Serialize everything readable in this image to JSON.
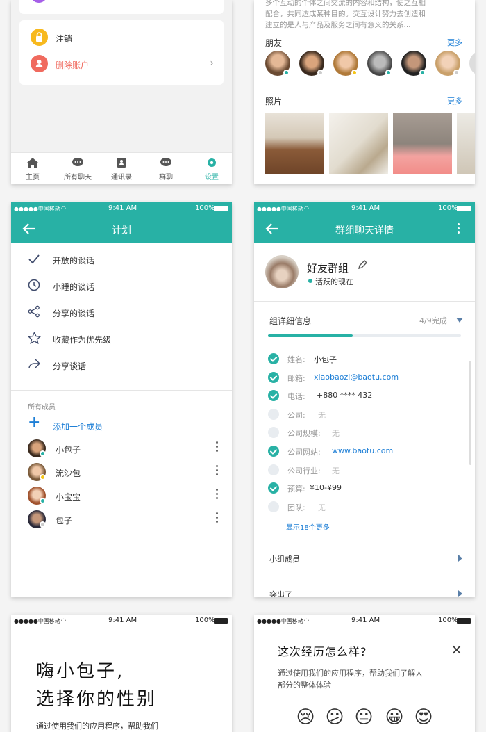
{
  "settings_tail": {
    "logout": "注销",
    "delete_account": "删除账户",
    "tabs": [
      {
        "label": "主页",
        "icon": "home-icon"
      },
      {
        "label": "所有聊天",
        "icon": "chat-icon"
      },
      {
        "label": "通讯录",
        "icon": "contacts-icon"
      },
      {
        "label": "群聊",
        "icon": "group-chat-icon"
      },
      {
        "label": "设置",
        "icon": "gear-icon"
      }
    ]
  },
  "profile_tail": {
    "desc_line1": "多个互动的个体之间交流的内容和结构，使之互相",
    "desc_line2": "配合，共同达成某种目的。交互设计努力去创造和",
    "desc_line3": "建立的是人与产品及服务之间有意义的关系...",
    "friends_title": "朋友",
    "friends_more": "更多",
    "photos_title": "照片",
    "photos_more": "更多"
  },
  "status": {
    "carrier": "●●●●●中国移动",
    "time": "9:41 AM",
    "battery": "100%"
  },
  "plan": {
    "title": "计划",
    "actions": [
      {
        "icon": "check-icon",
        "label": "开放的谈话"
      },
      {
        "icon": "clock-icon",
        "label": "小睡的谈话"
      },
      {
        "icon": "share-icon",
        "label": "分享的谈话"
      },
      {
        "icon": "star-icon",
        "label": "收藏作为优先级"
      },
      {
        "icon": "forward-icon",
        "label": "分享谈话"
      }
    ],
    "members_title": "所有成员",
    "add_member": "添加一个成员",
    "members": [
      {
        "name": "小包子",
        "status_color": "#28b1a5"
      },
      {
        "name": "流沙包",
        "status_color": "#f5c518"
      },
      {
        "name": "小宝宝",
        "status_color": "#28b1a5"
      },
      {
        "name": "包子",
        "status_color": "#cccccc"
      }
    ]
  },
  "group": {
    "title": "群组聊天详情",
    "name": "好友群组",
    "status": "活跃的现在",
    "section": "组详细信息",
    "progress_text": "4/9完成",
    "progress": 0.44,
    "fields": [
      {
        "k": "姓名:",
        "v": "小包子",
        "done": true,
        "style": ""
      },
      {
        "k": "邮箱:",
        "v": "xiaobaozi@baotu.com",
        "done": true,
        "style": "link"
      },
      {
        "k": "电话:",
        "v": "+880 **** 432",
        "done": true,
        "style": ""
      },
      {
        "k": "公司:",
        "v": "无",
        "done": false,
        "style": "none"
      },
      {
        "k": "公司规模:",
        "v": "无",
        "done": false,
        "style": "none"
      },
      {
        "k": "公司网站:",
        "v": "www.baotu.com",
        "done": true,
        "style": "link"
      },
      {
        "k": "公司行业:",
        "v": "无",
        "done": false,
        "style": "none"
      },
      {
        "k": "预算:",
        "v": "¥10-¥99",
        "done": true,
        "style": ""
      },
      {
        "k": "团队:",
        "v": "无",
        "done": false,
        "style": "none"
      }
    ],
    "show_more": "显示18个更多",
    "group_members": "小组成员",
    "highlight": "突出了"
  },
  "gender": {
    "title_line1": "嗨小包子,",
    "title_line2": "选择你的性别",
    "desc": "通过使用我们的应用程序，帮助我们"
  },
  "feedback": {
    "title": "这次经历怎么样?",
    "desc_line1": "通过使用我们的应用程序，帮助我们了解大",
    "desc_line2": "部分的整体体验",
    "emojis": [
      {
        "name": "crying-face-icon",
        "glyph": "😢"
      },
      {
        "name": "confused-face-icon",
        "glyph": "😕"
      },
      {
        "name": "neutral-face-icon",
        "glyph": "😐"
      },
      {
        "name": "grinning-face-icon",
        "glyph": "😀"
      },
      {
        "name": "heart-eyes-face-icon",
        "glyph": "😍"
      }
    ]
  }
}
